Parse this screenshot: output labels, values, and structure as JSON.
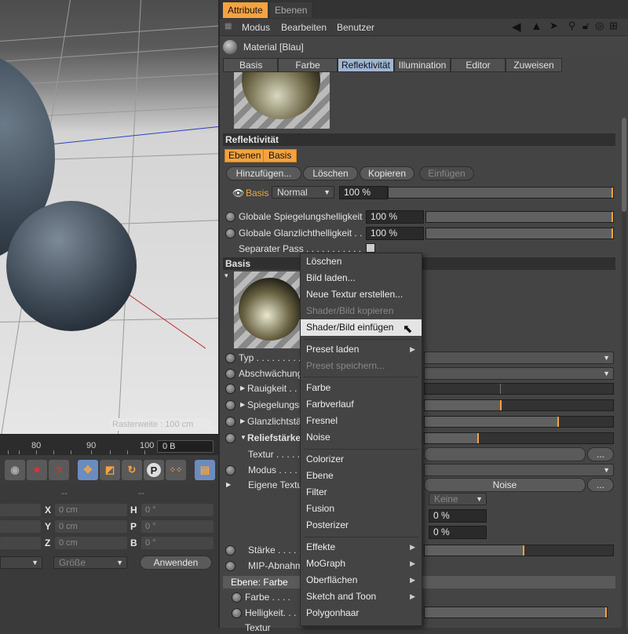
{
  "viewport": {
    "status": "Rasterweite : 100 cm",
    "ruler_ticks": [
      "80",
      "90",
      "100"
    ],
    "frame_field": "0 B"
  },
  "toolbar": {
    "icons": [
      "sphere-grey-icon",
      "record-icon",
      "help-icon",
      "move-icon",
      "scale-icon",
      "rotate-icon",
      "p-icon",
      "dots-icon",
      "film-icon"
    ]
  },
  "coords": {
    "dash1": "--",
    "dash2": "--",
    "rows": [
      {
        "l1": "X",
        "v1": "0 cm",
        "l2": "H",
        "v2": "0 °"
      },
      {
        "l1": "Y",
        "v1": "0 cm",
        "l2": "P",
        "v2": "0 °"
      },
      {
        "l1": "Z",
        "v1": "0 cm",
        "l2": "B",
        "v2": "0 °"
      }
    ],
    "size_dropdown": "Größe",
    "apply": "Anwenden"
  },
  "panel": {
    "tabs": [
      "Attribute",
      "Ebenen"
    ],
    "menu": [
      "Modus",
      "Bearbeiten",
      "Benutzer"
    ],
    "material_name": "Material [Blau]",
    "subtabs": [
      "Basis",
      "Farbe",
      "Reflektivität",
      "Illumination",
      "Editor",
      "Zuweisen"
    ],
    "section_reflect": "Reflektivität",
    "layer_tabs": [
      "Ebenen",
      "Basis"
    ],
    "buttons": [
      "Hinzufügen...",
      "Löschen",
      "Kopieren",
      "Einfügen"
    ],
    "layer_name": "Basis",
    "blend_mode": "Normal",
    "layer_pct": "100 %",
    "global_spec_label": "Globale Spiegelungshelligkeit",
    "global_spec_val": "100 %",
    "global_gloss_label": "Globale Glanzlichthelligkeit . .",
    "global_gloss_val": "100 %",
    "separate_pass": "Separater Pass . . . . . . . . . . .",
    "section_basis": "Basis",
    "typ": "Typ . . . . . . . . .",
    "abschwaechung": "Abschwächung",
    "rauigkeit": "Rauigkeit . . . .",
    "spiegelung": "Spiegelungss",
    "glanzlicht": "Glanzlichtstä",
    "relief": "Reliefstärke",
    "textur": "Textur . . . . .",
    "modus": "Modus . . . . .",
    "eigene": "Eigene Textu",
    "noise_btn": "Noise",
    "keine": "Keine",
    "pct1": "0 %",
    "pct2": "0 %",
    "staerke": "Stärke . . . . .",
    "mip": "MIP-Abnahm",
    "ebene_farbe": "Ebene: Farbe",
    "farbe": "Farbe . . . .",
    "helligkeit": "Helligkeit. . .",
    "textur2": "Textur"
  },
  "context_menu": {
    "items": [
      {
        "label": "Löschen",
        "disabled": false
      },
      {
        "label": "Bild laden...",
        "disabled": false
      },
      {
        "label": "Neue Textur erstellen...",
        "disabled": false
      },
      {
        "label": "Shader/Bild kopieren",
        "disabled": true
      },
      {
        "label": "Shader/Bild einfügen",
        "disabled": false,
        "highlighted": true
      },
      {
        "label": "Preset laden",
        "disabled": false,
        "submenu": true
      },
      {
        "label": "Preset speichern...",
        "disabled": true
      },
      {
        "label": "Farbe",
        "disabled": false
      },
      {
        "label": "Farbverlauf",
        "disabled": false
      },
      {
        "label": "Fresnel",
        "disabled": false
      },
      {
        "label": "Noise",
        "disabled": false
      },
      {
        "label": "Colorizer",
        "disabled": false
      },
      {
        "label": "Ebene",
        "disabled": false
      },
      {
        "label": "Filter",
        "disabled": false
      },
      {
        "label": "Fusion",
        "disabled": false
      },
      {
        "label": "Posterizer",
        "disabled": false
      },
      {
        "label": "Effekte",
        "disabled": false,
        "submenu": true
      },
      {
        "label": "MoGraph",
        "disabled": false,
        "submenu": true
      },
      {
        "label": "Oberflächen",
        "disabled": false,
        "submenu": true
      },
      {
        "label": "Sketch and Toon",
        "disabled": false,
        "submenu": true
      },
      {
        "label": "Polygonhaar",
        "disabled": false
      }
    ]
  },
  "colors": {
    "accent_orange": "#f4a340",
    "tab_selected": "#9fb6d4",
    "panel_bg": "#444444"
  }
}
